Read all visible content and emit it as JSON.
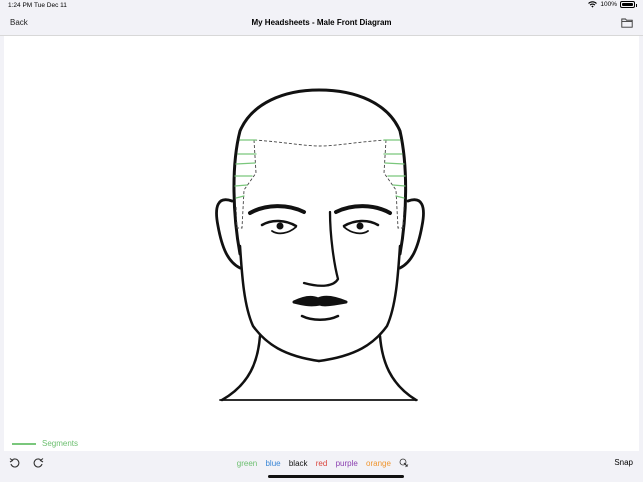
{
  "status": {
    "time": "1:24 PM",
    "date": "Tue Dec 11",
    "battery": "100%"
  },
  "nav": {
    "back_label": "Back",
    "title": "My Headsheets - Male Front Diagram"
  },
  "legend": {
    "label": "Segments",
    "color": "#7ac77c"
  },
  "toolbar": {
    "colors": [
      {
        "label": "green",
        "color": "#6cbf6f"
      },
      {
        "label": "blue",
        "color": "#3a86d6"
      },
      {
        "label": "black",
        "color": "#111111"
      },
      {
        "label": "red",
        "color": "#d9443b"
      },
      {
        "label": "purple",
        "color": "#8a3fb0"
      },
      {
        "label": "orange",
        "color": "#f0962f"
      }
    ],
    "snap_label": "Snap"
  },
  "icons": {
    "undo": "undo-icon",
    "redo": "redo-icon",
    "folder": "folder-icon",
    "pen": "pen-select-icon",
    "wifi": "wifi-icon",
    "battery": "battery-icon"
  }
}
